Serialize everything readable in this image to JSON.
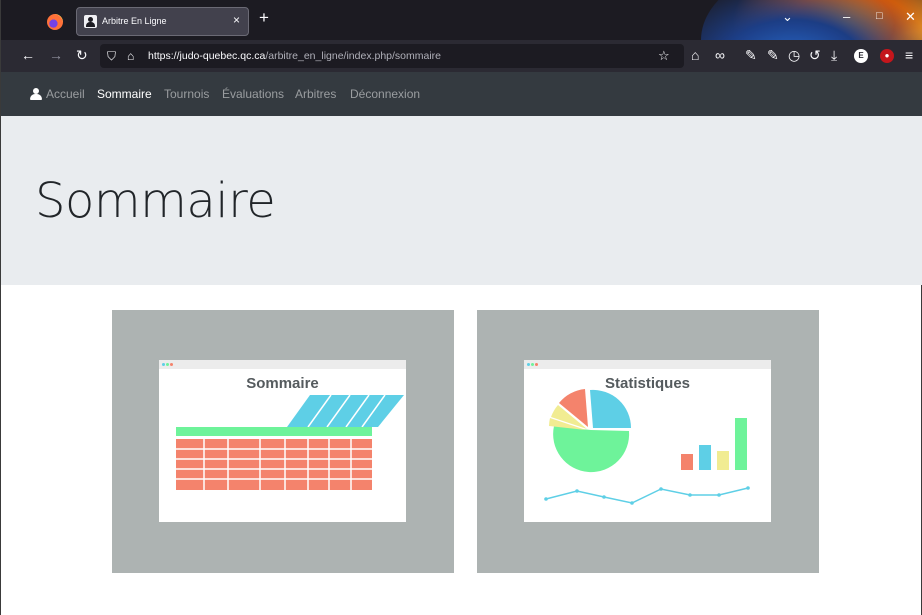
{
  "browser": {
    "tab_title": "Arbitre En Ligne",
    "tab_close": "×",
    "new_tab": "+",
    "url_host": "https://judo-quebec.qc.ca",
    "url_path": "/arbitre_en_ligne/index.php/sommaire",
    "window_controls": {
      "minimize": "–",
      "maximize": "□",
      "close": "✕"
    },
    "toolbar_icons": [
      "back-icon",
      "forward-icon",
      "reload-icon",
      "shield-icon",
      "lock-icon",
      "star-icon",
      "home-icon",
      "infinity-icon",
      "wrench-icon",
      "wrench-icon",
      "clock-icon",
      "history-icon",
      "download-icon",
      "extension-icon",
      "ublock-icon",
      "menu-icon"
    ],
    "extension_badge": "E"
  },
  "navbar": {
    "items": [
      {
        "label": "Accueil",
        "active": false
      },
      {
        "label": "Sommaire",
        "active": true
      },
      {
        "label": "Tournois",
        "active": false
      },
      {
        "label": "Évaluations",
        "active": false
      },
      {
        "label": "Arbitres",
        "active": false
      },
      {
        "label": "Déconnexion",
        "active": false
      }
    ]
  },
  "jumbotron": {
    "title": "Sommaire"
  },
  "cards": [
    {
      "title": "Sommaire"
    },
    {
      "title": "Statistiques"
    }
  ],
  "colors": {
    "navbar_bg": "#343a40",
    "jumbotron_bg": "#e9ecef",
    "card_bg": "#adb3b2",
    "table_red": "#f4836c",
    "table_green": "#6ef39a",
    "accent_cyan": "#5ecfe6",
    "pie_yellow": "#f1ec92"
  }
}
